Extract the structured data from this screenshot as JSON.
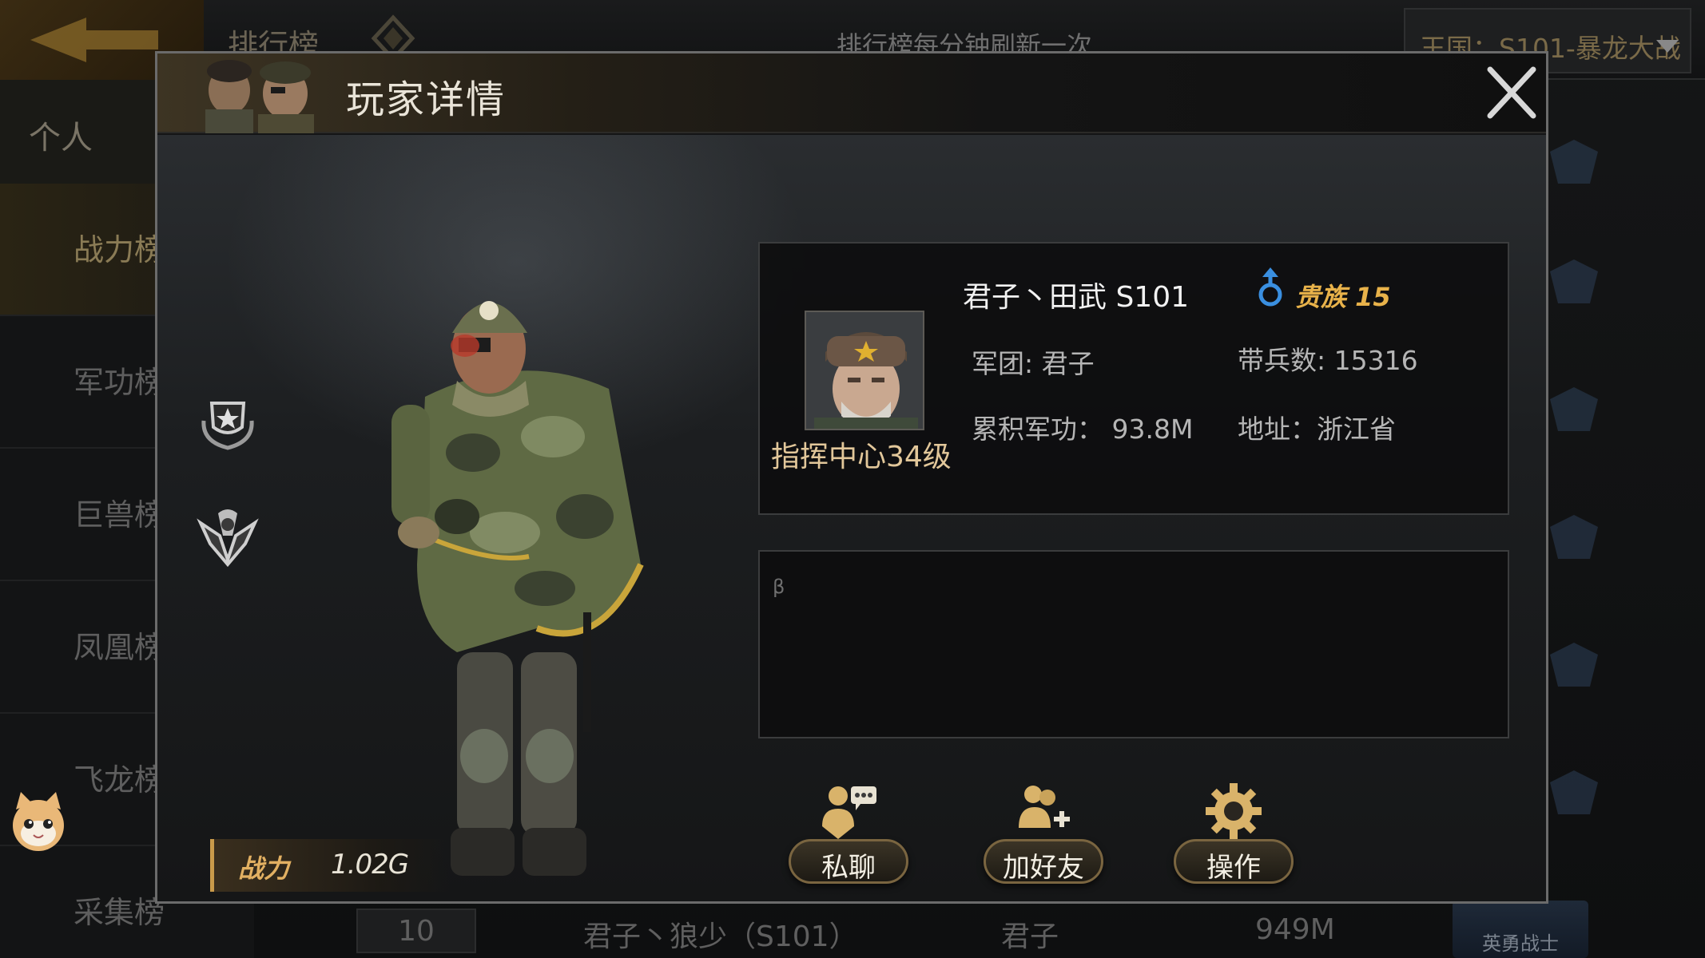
{
  "background": {
    "tab_title": "排行榜",
    "notice": "排行榜每分钟刷新一次",
    "kingdom_select": "王国：S101-暴龙大战",
    "sidebar": {
      "personal": "个人",
      "items": [
        "战力榜",
        "军功榜",
        "巨兽榜",
        "凤凰榜",
        "飞龙榜",
        "采集榜"
      ]
    },
    "bottom_row": {
      "rank": "10",
      "name": "君子丶狼少（S101）",
      "legion": "君子",
      "value": "949M",
      "badge": "英勇战士"
    }
  },
  "modal": {
    "title": "玩家详情",
    "close_icon": "close-icon",
    "power": {
      "label": "战力",
      "value": "1.02G"
    },
    "info": {
      "name": "君子丶田武 S101",
      "gender_icon": "male-icon",
      "noble": "贵族 15",
      "command_level": "指挥中心34级",
      "legion": "军团: 君子",
      "troops": "带兵数: 15316",
      "merit": "累积军功： 93.8M",
      "address": "地址：浙江省"
    },
    "signature": "β",
    "actions": {
      "chat": "私聊",
      "add_friend": "加好友",
      "operate": "操作"
    }
  },
  "colors": {
    "accent_gold": "#e2b062",
    "noble_gold": "#e8b24a",
    "gender_blue": "#3a8fe0",
    "panel_border": "#3b3c3d"
  }
}
